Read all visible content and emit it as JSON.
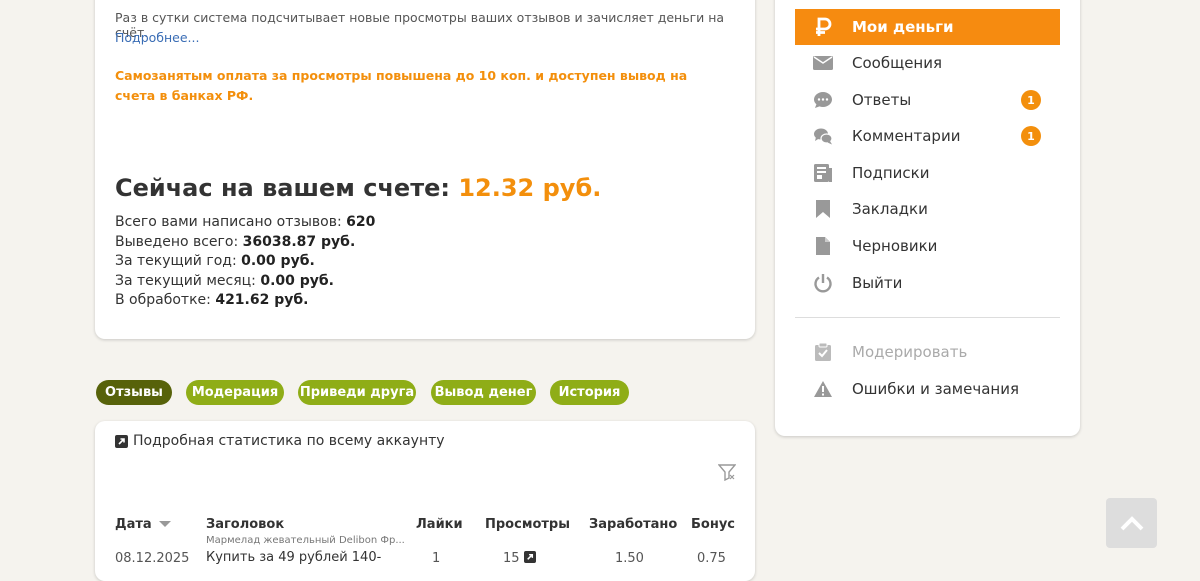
{
  "account": {
    "info_text": "Раз в сутки система подсчитывает новые просмотры ваших отзывов и зачисляет деньги на счёт.",
    "more_link": "Подробнее...",
    "promo_text": "Самозанятым оплата за просмотры повышена до 10 коп. и доступен вывод на счета в банках РФ.",
    "balance_label": "Сейчас на вашем счете:",
    "balance_value": "12.32 руб.",
    "stats": [
      {
        "label": "Всего вами написано отзывов:",
        "value": "620"
      },
      {
        "label": "Выведено всего:",
        "value": "36038.87 руб."
      },
      {
        "label": "За текущий год:",
        "value": "0.00 руб."
      },
      {
        "label": "За текущий месяц:",
        "value": "0.00 руб."
      },
      {
        "label": "В обработке:",
        "value": "421.62 руб."
      }
    ]
  },
  "sidebar": {
    "items": [
      {
        "label": "Мои деньги",
        "icon": "ruble-icon",
        "active": true
      },
      {
        "label": "Сообщения",
        "icon": "envelope-icon"
      },
      {
        "label": "Ответы",
        "icon": "chat-bubble-icon",
        "badge": "1"
      },
      {
        "label": "Комментарии",
        "icon": "comments-icon",
        "badge": "1"
      },
      {
        "label": "Подписки",
        "icon": "subscriptions-icon"
      },
      {
        "label": "Закладки",
        "icon": "bookmark-icon"
      },
      {
        "label": "Черновики",
        "icon": "document-icon"
      },
      {
        "label": "Выйти",
        "icon": "power-icon"
      }
    ],
    "moderation": {
      "label": "Модерировать",
      "icon": "clipboard-check-icon"
    },
    "errors": {
      "label": "Ошибки и замечания",
      "icon": "warning-icon"
    }
  },
  "tabs": [
    {
      "label": "Отзывы",
      "active": true
    },
    {
      "label": "Модерация"
    },
    {
      "label": "Приведи друга"
    },
    {
      "label": "Вывод денег"
    },
    {
      "label": "История"
    }
  ],
  "statistics": {
    "title": "Подробная статистика по всему аккаунту",
    "columns": [
      "Дата",
      "Заголовок",
      "Лайки",
      "Просмотры",
      "Заработано",
      "Бонус"
    ],
    "rows": [
      {
        "date": "08.12.2025",
        "category": "Мармелад жевательный Delibon Фр...",
        "title": "Купить за 49 рублей 140-",
        "likes": "1",
        "views": "15",
        "earned": "1.50",
        "bonus": "0.75"
      }
    ]
  },
  "colors": {
    "accent": "#f68b10",
    "tab": "#8fad17",
    "tab_active": "#57620a",
    "link": "#3a6db5"
  }
}
